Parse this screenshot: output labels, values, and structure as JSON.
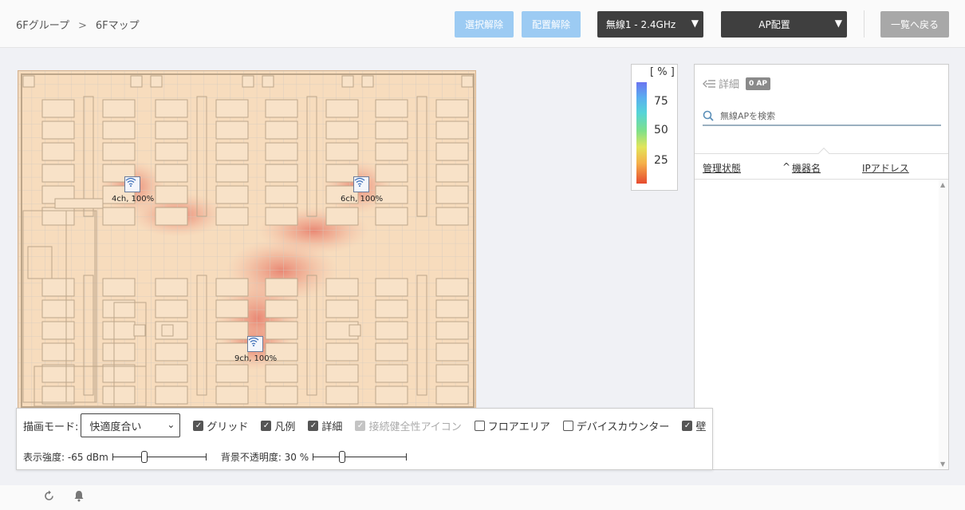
{
  "header": {
    "breadcrumb": {
      "group": "6Fグループ",
      "separator": ">",
      "map": "6Fマップ"
    },
    "buttons": {
      "deselect": "選択解除",
      "unplace": "配置解除",
      "band_select": "無線1 - 2.4GHz",
      "ap_place": "AP配置",
      "back_to_list": "一覧へ戻る"
    },
    "colors": {
      "light_button": "#9ccbf3",
      "dark_button": "#3f3f3f",
      "grey_button": "#a8a8a8"
    }
  },
  "map": {
    "access_points": [
      {
        "label": "4ch, 100%"
      },
      {
        "label": "6ch, 100%"
      },
      {
        "label": "9ch, 100%"
      }
    ]
  },
  "legend": {
    "unit": "[ % ]",
    "ticks": [
      "75",
      "50",
      "25"
    ]
  },
  "panel": {
    "detail_label": "詳細",
    "ap_count": "0 AP",
    "search_placeholder": "無線APを検索",
    "columns": {
      "status": "管理状態",
      "sort_indicator": "^",
      "device_name": "機器名",
      "ip_address": "IPアドレス"
    }
  },
  "toolbar": {
    "mode_label": "描画モード:",
    "mode_value": "快適度合い",
    "checkboxes": {
      "grid": {
        "label": "グリッド",
        "checked": true
      },
      "legend": {
        "label": "凡例",
        "checked": true
      },
      "detail": {
        "label": "詳細",
        "checked": true
      },
      "connection_health_icon": {
        "label": "接続健全性アイコン",
        "checked": true,
        "disabled": true
      },
      "floor_area": {
        "label": "フロアエリア",
        "checked": false
      },
      "device_counter": {
        "label": "デバイスカウンター",
        "checked": false
      },
      "wall": {
        "label": "壁",
        "checked": true
      }
    },
    "strength_label": "表示強度: -65 dBm",
    "strength_fraction": 0.33,
    "opacity_label": "背景不透明度: 30 %",
    "opacity_fraction": 0.3
  },
  "footer": {
    "refresh_icon": "refresh-icon",
    "bell_icon": "bell-icon"
  }
}
